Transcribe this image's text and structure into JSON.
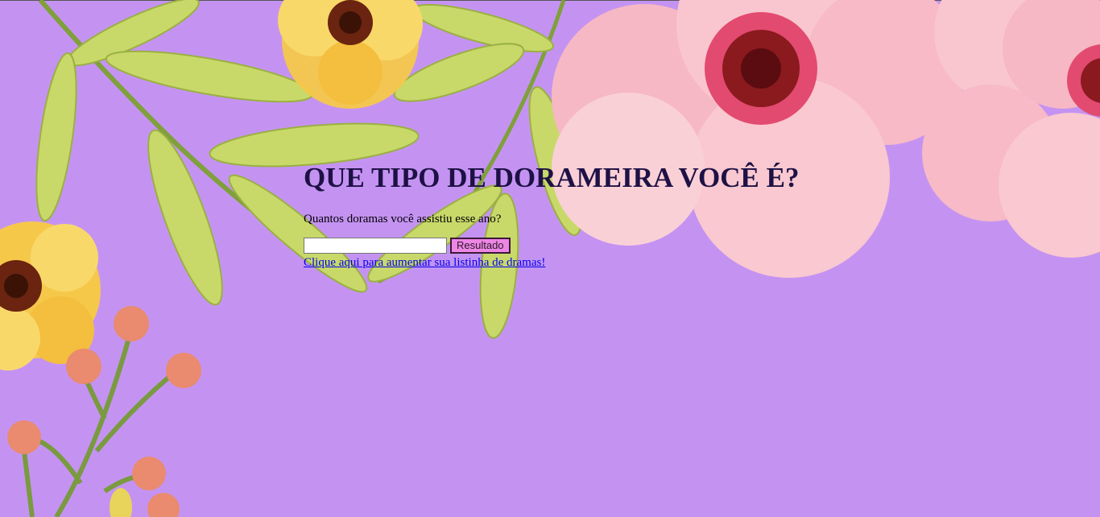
{
  "page": {
    "title": "QUE TIPO DE DORAMEIRA VOCÊ É?",
    "question": "Quantos doramas você assistiu esse ano?",
    "input_value": "",
    "input_placeholder": "",
    "button_label": "Resultado",
    "link_text": "Clique aqui para aumentar sua listinha de dramas!"
  },
  "colors": {
    "background": "#c493f2",
    "title": "#1e1145",
    "button": "#ee86e4",
    "link": "#0000ee"
  }
}
